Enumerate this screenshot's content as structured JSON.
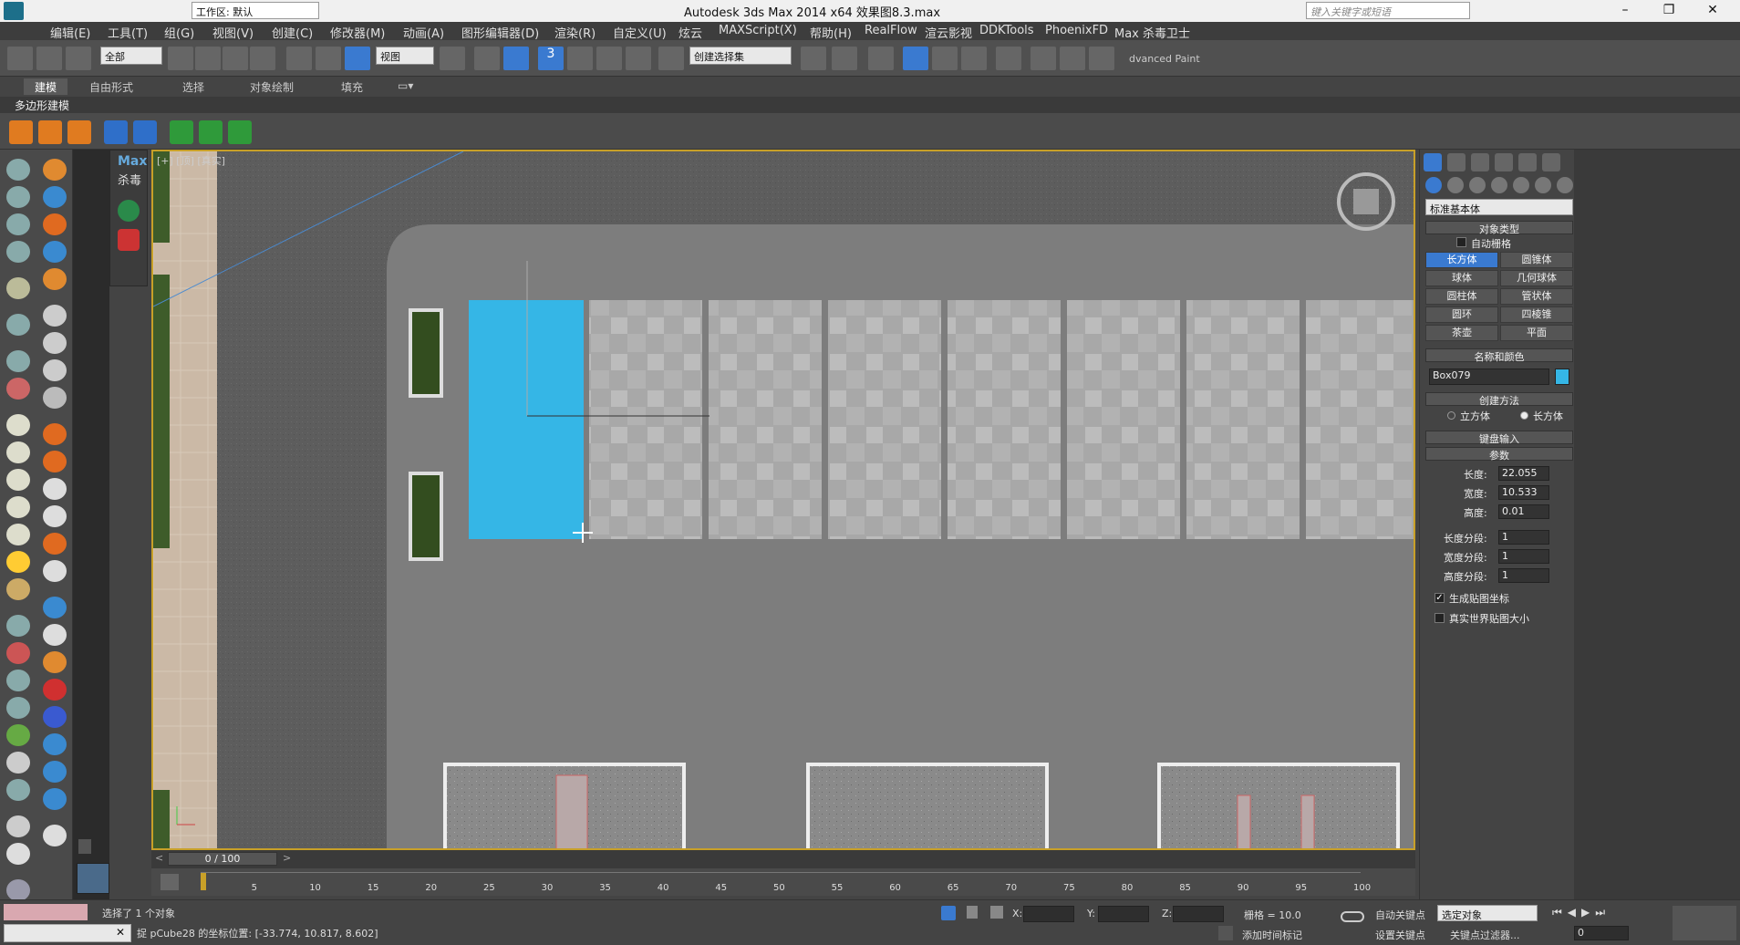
{
  "window": {
    "title": "Autodesk 3ds Max  2014 x64      效果图8.3.max",
    "workspace": "工作区: 默认",
    "search_placeholder": "键入关键字或短语"
  },
  "menu": [
    "编辑(E)",
    "工具(T)",
    "组(G)",
    "视图(V)",
    "创建(C)",
    "修改器(M)",
    "动画(A)",
    "图形编辑器(D)",
    "渲染(R)",
    "自定义(U)",
    "炫云",
    "MAXScript(X)",
    "帮助(H)",
    "RealFlow",
    "渲云影视",
    "DDKTools",
    "PhoenixFD",
    "Max 杀毒卫士"
  ],
  "toolbar": {
    "selection_filter": "全部",
    "ref_coord": "视图",
    "named_sel": "创建选择集",
    "advanced_paint": "dvanced Paint",
    "snap_label": "3"
  },
  "ribbon": {
    "tabs": [
      "建模",
      "自由形式",
      "选择",
      "对象绘制",
      "填充"
    ],
    "sub": "多边形建模"
  },
  "maxpanel": {
    "title": "Max",
    "sub": "杀毒"
  },
  "viewport": {
    "label": "[+] [顶] [真实]"
  },
  "command_panel": {
    "category": "标准基本体",
    "object_type": {
      "title": "对象类型",
      "autogrid": "自动栅格",
      "buttons": [
        "长方体",
        "圆锥体",
        "球体",
        "几何球体",
        "圆柱体",
        "管状体",
        "圆环",
        "四棱锥",
        "茶壶",
        "平面"
      ]
    },
    "name_color": {
      "title": "名称和颜色",
      "name": "Box079",
      "color": "#35b6e6"
    },
    "creation": {
      "title": "创建方法",
      "opt1": "立方体",
      "opt2": "长方体"
    },
    "keyboard": "键盘输入",
    "params": {
      "title": "参数",
      "length_l": "长度:",
      "length": "22.055",
      "width_l": "宽度:",
      "width": "10.533",
      "height_l": "高度:",
      "height": "0.01",
      "lseg_l": "长度分段:",
      "lseg": "1",
      "wseg_l": "宽度分段:",
      "wseg": "1",
      "hseg_l": "高度分段:",
      "hseg": "1",
      "gen_map": "生成贴图坐标",
      "real_world": "真实世界贴图大小"
    }
  },
  "timeline": {
    "frame": "0 / 100",
    "ticks": [
      "5",
      "10",
      "15",
      "20",
      "25",
      "30",
      "35",
      "40",
      "45",
      "50",
      "55",
      "60",
      "65",
      "70",
      "75",
      "80",
      "85",
      "90",
      "95",
      "100"
    ]
  },
  "status": {
    "selected": "选择了 1 个对象",
    "prompt": "捉 pCube28 的坐标位置: [-33.774, 10.817, 8.602]",
    "x": "X:",
    "y": "Y:",
    "z": "Z:",
    "grid": "栅格 = 10.0",
    "autokey": "自动关键点",
    "setkey": "设置关键点",
    "key_mode": "选定对象",
    "add_time_tag": "添加时间标记",
    "key_filter": "关键点过滤器...",
    "frame_value": "0"
  }
}
